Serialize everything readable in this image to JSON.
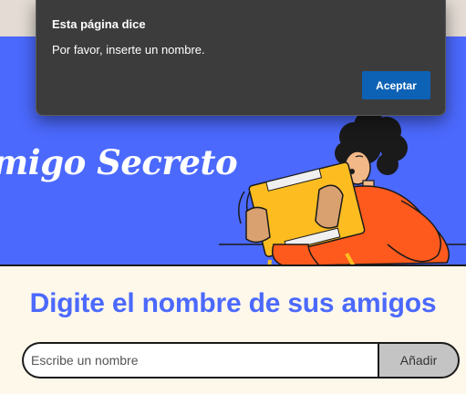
{
  "hero": {
    "title": "migo Secreto"
  },
  "main": {
    "section_title": "Digite el nombre de sus amigos",
    "name_input": {
      "placeholder": "Escribe un nombre",
      "value": ""
    },
    "add_button_label": "Añadir"
  },
  "alert_dialog": {
    "title": "Esta página dice",
    "message": "Por favor, inserte un nombre.",
    "ok_label": "Aceptar"
  },
  "colors": {
    "hero_background": "#4b69fd",
    "page_background": "#fef8eb",
    "accent_text": "#4b69fd",
    "dialog_background": "#3c3c3c",
    "dialog_button": "#0e62b5",
    "add_button_background": "#c4c4c4",
    "person_shirt": "#fe5a1d",
    "gift_box": "#fdbd21"
  },
  "icons": {
    "illustration": "person-holding-gift-illustration"
  }
}
